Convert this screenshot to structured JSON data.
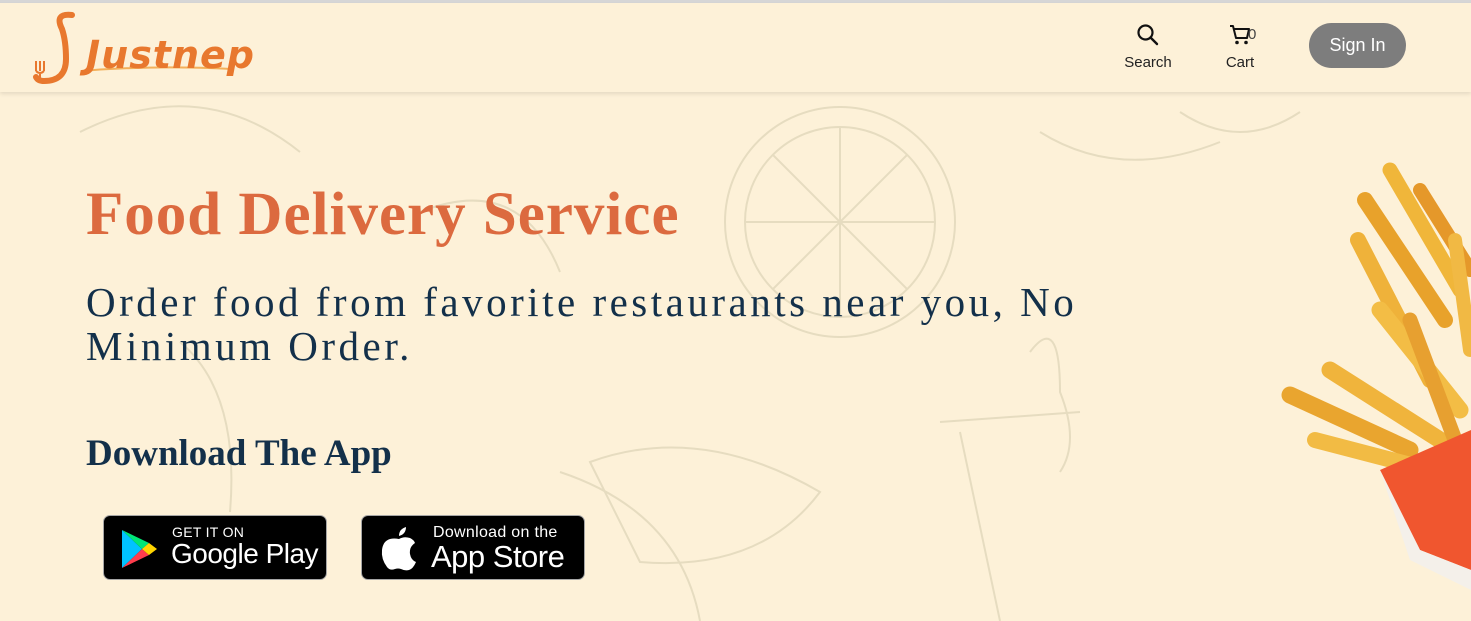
{
  "header": {
    "logo_text": "Justnep",
    "search_label": "Search",
    "cart_label": "Cart",
    "cart_count": "0",
    "signin_label": "Sign In"
  },
  "hero": {
    "title": "Food Delivery Service",
    "subtitle": "Order food from favorite restaurants near you, No Minimum Order.",
    "download_title": "Download The App"
  },
  "badges": {
    "google_play": {
      "small": "GET IT ON",
      "big": "Google Play"
    },
    "app_store": {
      "small": "Download on the",
      "big": "App Store"
    }
  },
  "colors": {
    "background": "#fdf1d8",
    "brand_orange": "#e8782e",
    "title_orange": "#dc6a3f",
    "navy_text": "#13304a",
    "signin_gray": "#7d7d7d"
  },
  "icons": [
    "search-icon",
    "cart-icon",
    "fork-icon",
    "google-play-icon",
    "apple-icon"
  ]
}
